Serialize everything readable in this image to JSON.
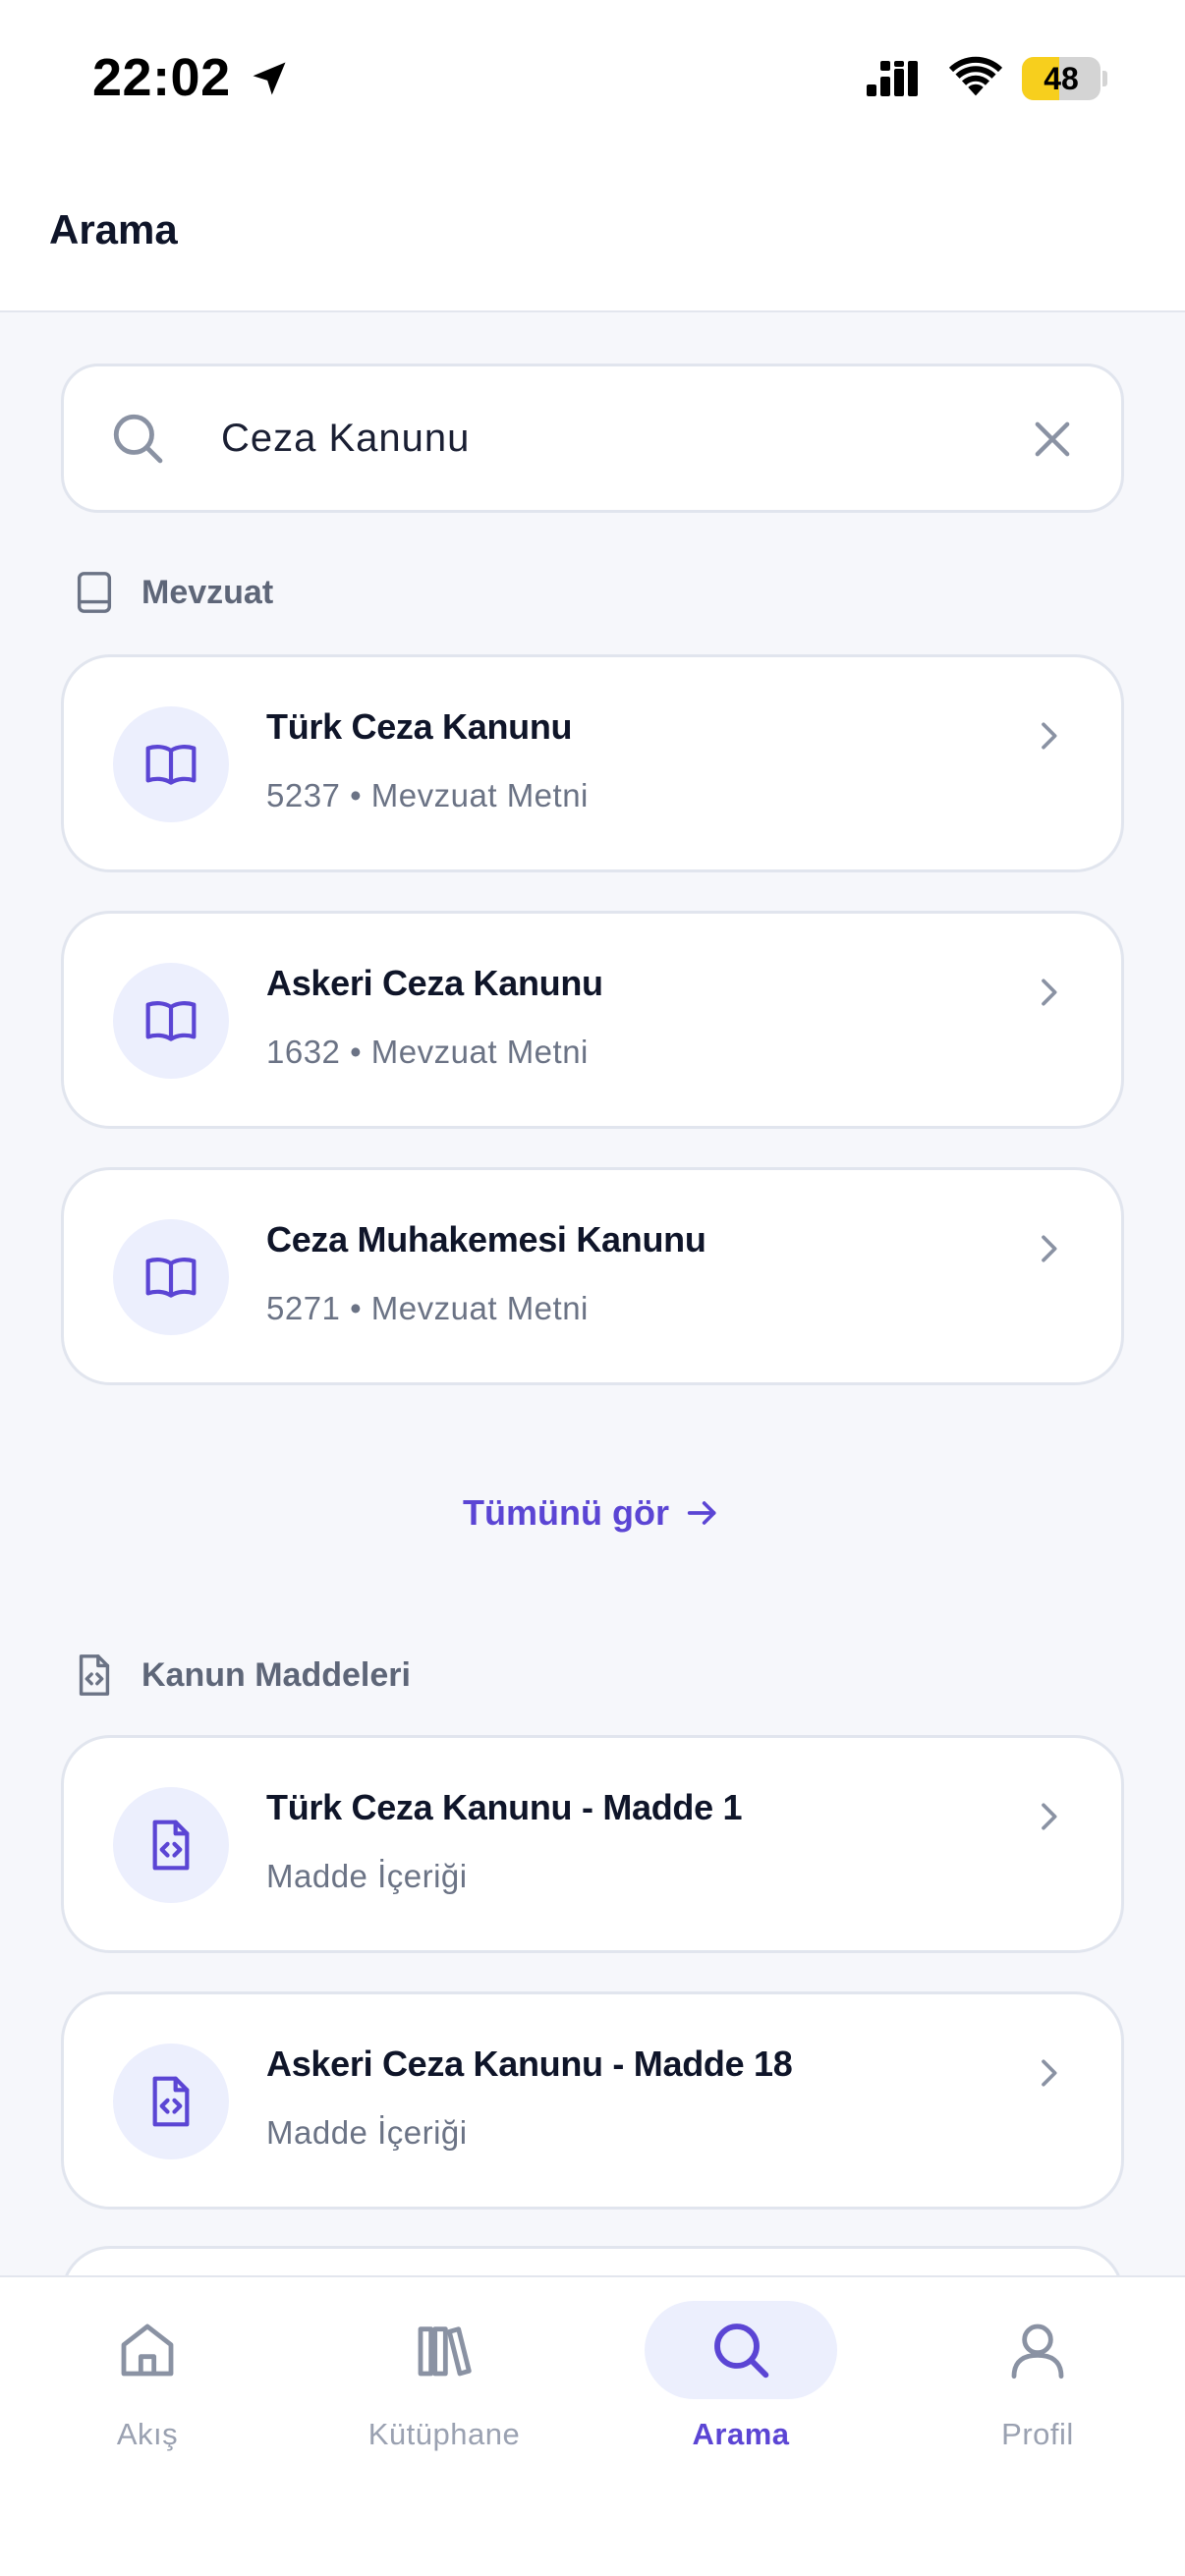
{
  "status_bar": {
    "time": "22:02",
    "battery": "48",
    "battery_level": 0.48,
    "battery_color": "#f7cf1d",
    "icons": [
      "location-arrow-icon",
      "signal-icon",
      "wifi-icon",
      "battery-icon"
    ]
  },
  "header": {
    "title": "Arama"
  },
  "search": {
    "value": "Ceza Kanunu",
    "placeholder": "",
    "icons": [
      "search-icon",
      "clear-icon"
    ]
  },
  "sections": {
    "mevzuat": {
      "label": "Mevzuat",
      "icon": "book-icon",
      "items": [
        {
          "title": "Türk Ceza Kanunu",
          "subtitle": "5237 • Mevzuat Metni",
          "icon": "open-book-icon"
        },
        {
          "title": "Askeri Ceza Kanunu",
          "subtitle": "1632 • Mevzuat Metni",
          "icon": "open-book-icon"
        },
        {
          "title": "Ceza Muhakemesi Kanunu",
          "subtitle": "5271 • Mevzuat Metni",
          "icon": "open-book-icon"
        }
      ],
      "see_all": "Tümünü gör"
    },
    "maddeler": {
      "label": "Kanun Maddeleri",
      "icon": "code-file-icon",
      "items": [
        {
          "title": "Türk Ceza Kanunu - Madde 1",
          "subtitle": "Madde İçeriği",
          "icon": "code-file-icon"
        },
        {
          "title": "Askeri Ceza Kanunu - Madde 18",
          "subtitle": "Madde İçeriği",
          "icon": "code-file-icon"
        }
      ]
    }
  },
  "bottom_nav": {
    "items": [
      {
        "label": "Akış",
        "icon": "home-icon",
        "active": false
      },
      {
        "label": "Kütüphane",
        "icon": "library-icon",
        "active": false
      },
      {
        "label": "Arama",
        "icon": "search-icon",
        "active": true
      },
      {
        "label": "Profil",
        "icon": "user-icon",
        "active": false
      }
    ]
  },
  "colors": {
    "accent": "#5b45d4",
    "accent_soft": "#eceffd",
    "text_primary": "#0f1529",
    "text_secondary": "#6b7385",
    "background": "#f6f7fb"
  }
}
